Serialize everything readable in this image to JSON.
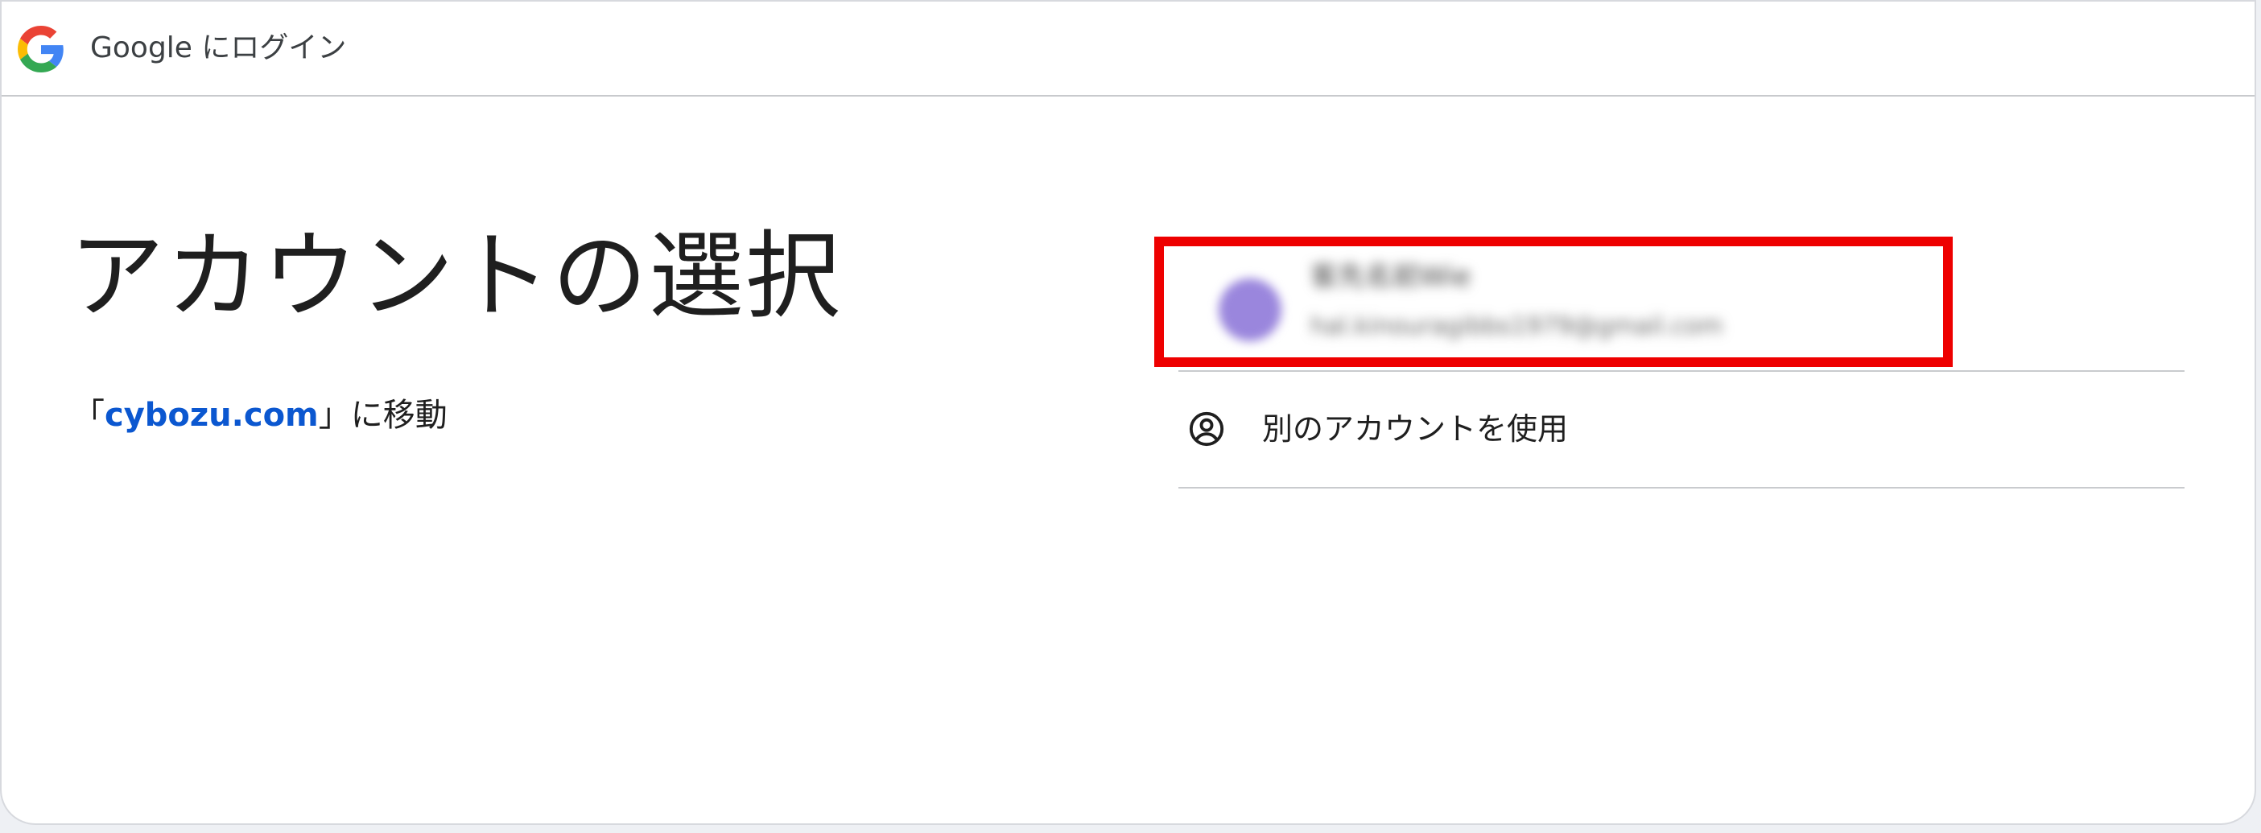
{
  "header": {
    "brand": "Google",
    "title_suffix": " にログイン"
  },
  "main": {
    "heading": "アカウントの選択",
    "continue_prefix": "「",
    "continue_link": "cybozu.com",
    "continue_suffix": "」に移動"
  },
  "accounts": [
    {
      "name": "客先名前Wie",
      "email": "hal.kinouragibbs1979@gmail.com",
      "avatar_color": "#9a86dd"
    }
  ],
  "other_account": {
    "label": "別のアカウントを使用"
  },
  "colors": {
    "link": "#0b57d0",
    "highlight": "#ee0000",
    "divider": "#c9cbce"
  },
  "icons": {
    "logo": "google-g-logo-icon",
    "other_account": "account-circle-icon"
  }
}
